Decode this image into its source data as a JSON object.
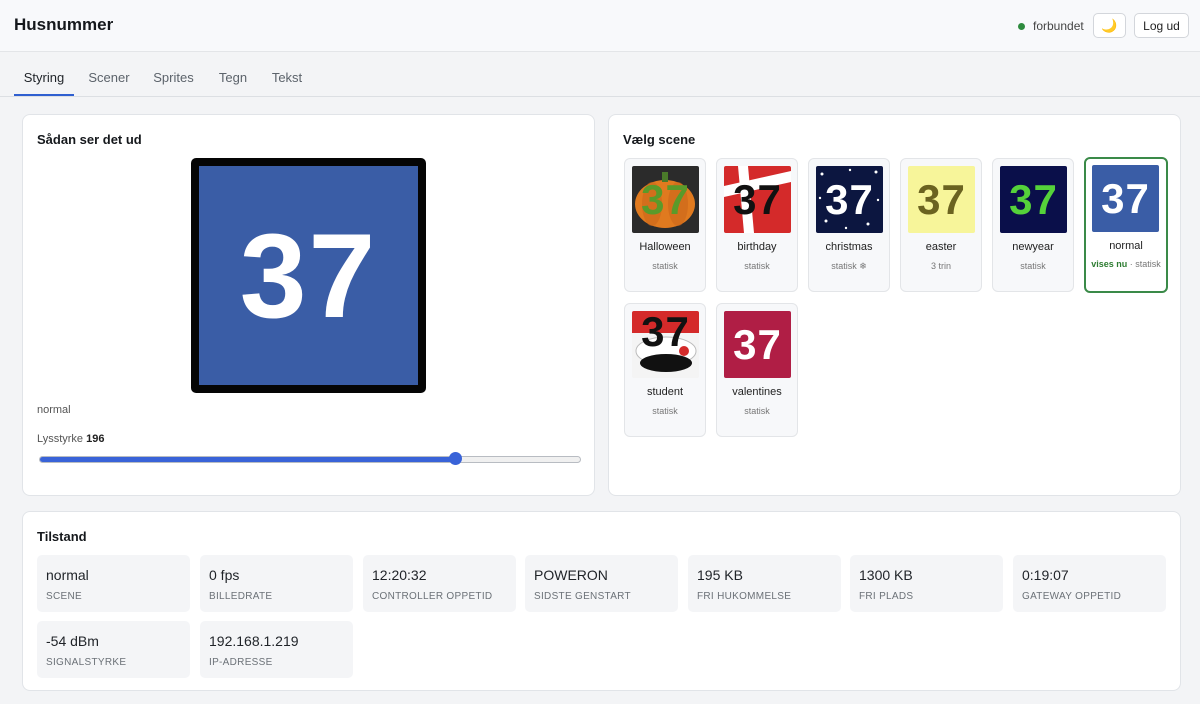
{
  "header": {
    "title": "Husnummer",
    "status_text": "forbundet",
    "status_color": "#2e8b3e",
    "theme_icon": "moon-icon",
    "theme_glyph": "🌙",
    "logout_label": "Log ud"
  },
  "tabs": [
    {
      "label": "Styring",
      "active": true
    },
    {
      "label": "Scener",
      "active": false
    },
    {
      "label": "Sprites",
      "active": false
    },
    {
      "label": "Tegn",
      "active": false
    },
    {
      "label": "Tekst",
      "active": false
    }
  ],
  "preview": {
    "title": "Sådan ser det ud",
    "number": "37",
    "scene_name": "normal",
    "brightness_label": "Lysstyrke",
    "brightness_value": "196",
    "brightness_max": 255,
    "tile_color": "#3a5da6"
  },
  "scenes": {
    "title": "Vælg scene",
    "items": [
      {
        "name": "Halloween",
        "sub": "statisk",
        "number": "37",
        "selected": false
      },
      {
        "name": "birthday",
        "sub": "statisk",
        "number": "37",
        "selected": false
      },
      {
        "name": "christmas",
        "sub": "statisk ❄",
        "number": "37",
        "selected": false
      },
      {
        "name": "easter",
        "sub": "3 trin",
        "number": "37",
        "selected": false
      },
      {
        "name": "newyear",
        "sub": "statisk",
        "number": "37",
        "selected": false
      },
      {
        "name": "normal",
        "sub_now": "vises nu",
        "sub": "· statisk",
        "number": "37",
        "selected": true
      },
      {
        "name": "student",
        "sub": "statisk",
        "number": "37",
        "selected": false
      },
      {
        "name": "valentines",
        "sub": "statisk",
        "number": "37",
        "selected": false
      }
    ]
  },
  "status": {
    "title": "Tilstand",
    "items": [
      {
        "value": "normal",
        "label": "Scene"
      },
      {
        "value": "0 fps",
        "label": "Billedrate"
      },
      {
        "value": "12:20:32",
        "label": "Controller oppetid"
      },
      {
        "value": "POWERON",
        "label": "Sidste genstart"
      },
      {
        "value": "195 KB",
        "label": "Fri hukommelse"
      },
      {
        "value": "1300 KB",
        "label": "Fri plads"
      },
      {
        "value": "0:19:07",
        "label": "Gateway oppetid"
      },
      {
        "value": "-54 dBm",
        "label": "Signalstyrke"
      },
      {
        "value": "192.168.1.219",
        "label": "IP-adresse"
      }
    ]
  }
}
